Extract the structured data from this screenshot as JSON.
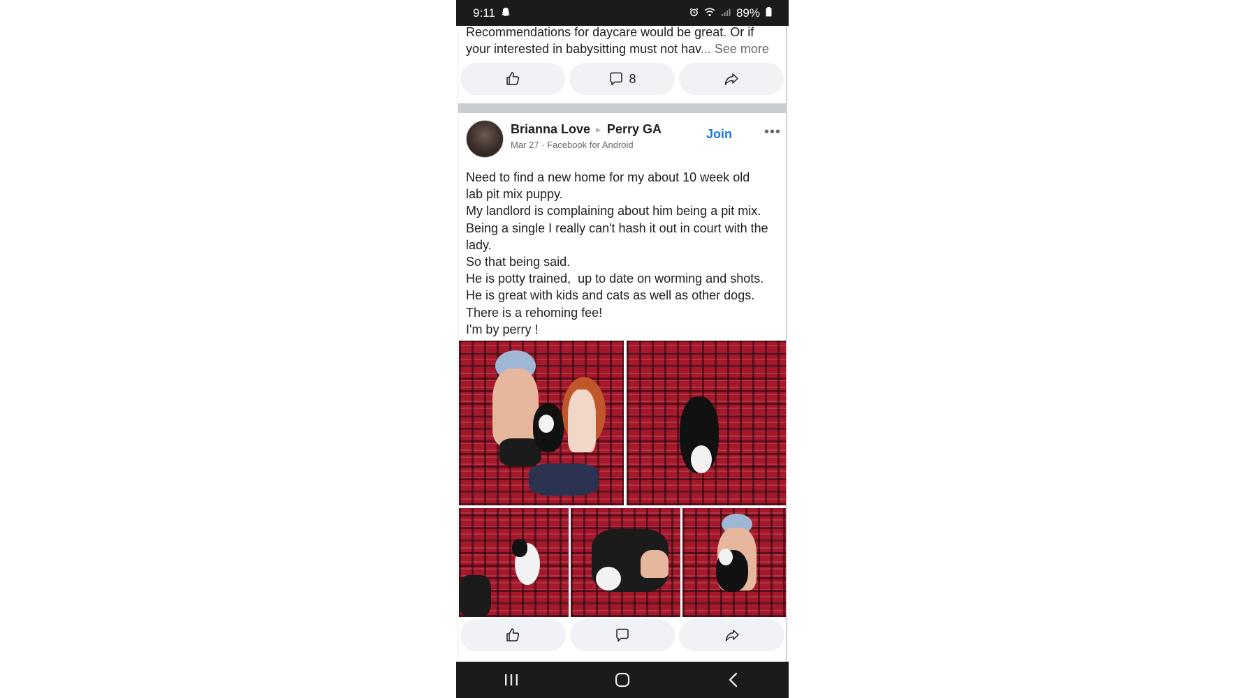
{
  "status_bar": {
    "time": "9:11",
    "battery": "89%",
    "icons": [
      "snapchat-ghost-icon",
      "alarm-icon",
      "wifi-icon",
      "signal-icon",
      "battery-icon"
    ]
  },
  "previous_post": {
    "text_line_1": "Recommendations for daycare would be great. Or if",
    "text_line_2": "your interested in babysitting  must not hav",
    "ellipsis": "...",
    "see_more": "See more",
    "comment_count": "8"
  },
  "post": {
    "author": "Brianna  Love",
    "group": "Perry GA",
    "date": "Mar 27",
    "dot": "·",
    "source": "Facebook for Android",
    "join_label": "Join",
    "more_label": "•••",
    "lines": [
      "Need to find a new home for my about 10 week old",
      "lab pit mix puppy.",
      "My landlord is complaining about him being a pit mix.",
      "Being a single I really can't hash it out in court with the",
      "lady.",
      "So that being said.",
      "He is potty trained,  up to date on worming and shots.",
      "He is great with kids and cats as well as other dogs.",
      "There is a rehoming fee!",
      "I'm by perry !"
    ],
    "photo_count": 5
  },
  "colors": {
    "accent": "#1877f2",
    "button_bg": "#f0f2f5",
    "secondary_text": "#65676b",
    "system_bar": "#1b1b1b",
    "plaid_red": "#a5182c"
  }
}
